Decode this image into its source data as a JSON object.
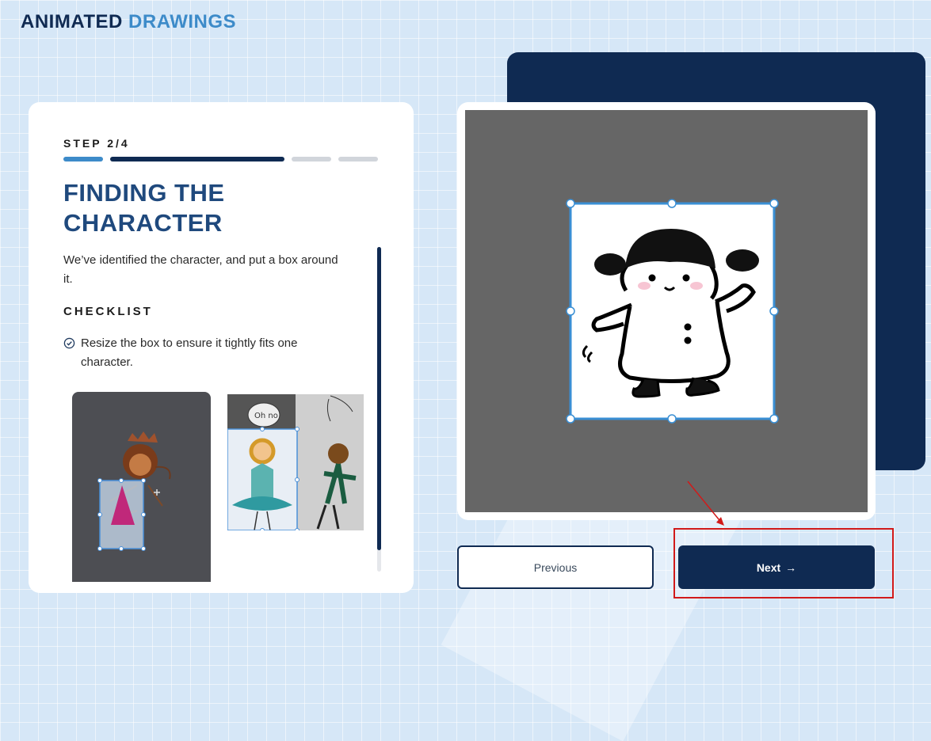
{
  "brand": {
    "part1": "ANIMATED",
    "part2": "DRAWINGS"
  },
  "step": {
    "label": "STEP 2/4",
    "current": 2,
    "total": 4
  },
  "title_line1": "FINDING THE",
  "title_line2": "CHARACTER",
  "description": "We’ve identified the character, and put a box around it.",
  "checklist": {
    "heading": "CHECKLIST",
    "items": [
      "Resize the box to ensure it tightly fits one character."
    ]
  },
  "examples": {
    "speech_bubble_text": "Oh no"
  },
  "buttons": {
    "previous": "Previous",
    "next": "Next",
    "next_arrow": "→"
  },
  "colors": {
    "navy": "#0f2a52",
    "accent_blue": "#3d8bc9",
    "handle_blue": "#3a8fd4",
    "canvas_gray": "#666666",
    "annotation_red": "#d11a1a"
  },
  "icons": [
    "check-circle-icon",
    "arrow-right-icon",
    "move-cursor-icon"
  ]
}
